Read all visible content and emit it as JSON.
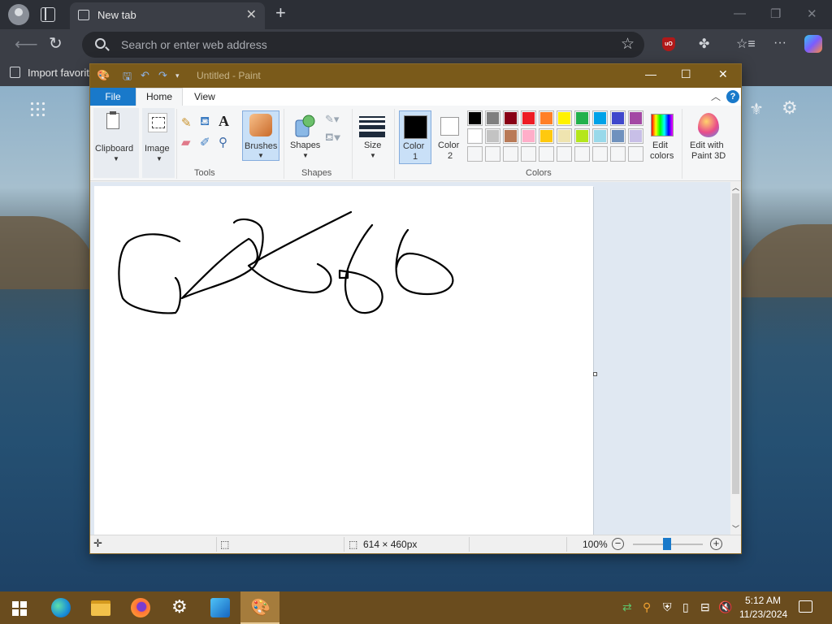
{
  "browser": {
    "tab_title": "New tab",
    "tab_close": "✕",
    "new_tab": "+",
    "window_controls": [
      "—",
      "❐",
      "✕"
    ],
    "address_placeholder": "Search or enter web address",
    "favorites_item": "Import favorites"
  },
  "paint": {
    "window_title": "Untitled - Paint",
    "window_controls": [
      "—",
      "☐",
      "✕"
    ],
    "tabs": {
      "file": "File",
      "home": "Home",
      "view": "View"
    },
    "help": "?",
    "ribbon": {
      "clipboard": "Clipboard",
      "image": "Image",
      "tools_group": "Tools",
      "brushes": "Brushes",
      "shapes": "Shapes",
      "shapes_group": "Shapes",
      "size": "Size",
      "color1_line1": "Color",
      "color1_line2": "1",
      "color2_line1": "Color",
      "color2_line2": "2",
      "colors_group": "Colors",
      "edit_colors_line1": "Edit",
      "edit_colors_line2": "colors",
      "paint3d_line1": "Edit with",
      "paint3d_line2": "Paint 3D"
    },
    "color1": "#000000",
    "color2": "#ffffff",
    "palette_row1": [
      "#000000",
      "#7f7f7f",
      "#880015",
      "#ed1c24",
      "#ff7f27",
      "#fff200",
      "#22b14c",
      "#00a2e8",
      "#3f48cc",
      "#a349a4"
    ],
    "palette_row2": [
      "#ffffff",
      "#c3c3c3",
      "#b97a57",
      "#ffaec9",
      "#ffc90e",
      "#efe4b0",
      "#b5e61d",
      "#99d9ea",
      "#7092be",
      "#c8bfe7"
    ],
    "status": {
      "canvas_size": "614 × 460px",
      "zoom": "100%"
    }
  },
  "taskbar": {
    "time": "5:12 AM",
    "date": "11/23/2024"
  }
}
